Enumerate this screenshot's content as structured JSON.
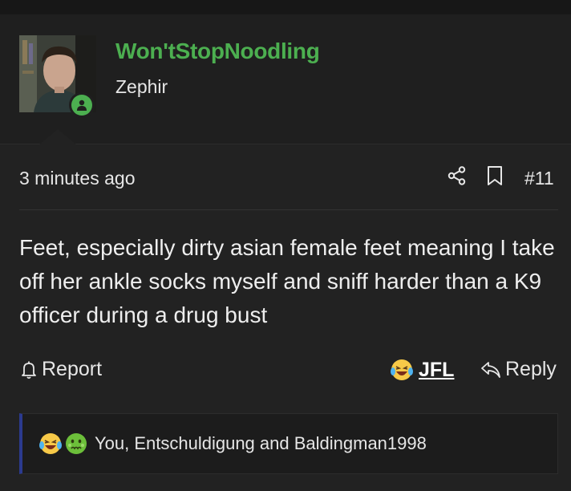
{
  "user": {
    "name": "Won'tStopNoodling",
    "title": "Zephir",
    "status": "online"
  },
  "post": {
    "timestamp": "3 minutes ago",
    "number": "#11",
    "body": "Feet, especially dirty asian female feet meaning I take off her ankle socks myself and sniff harder than a K9 officer during a drug bust"
  },
  "actions": {
    "report_label": "Report",
    "react_label": "JFL",
    "reply_label": "Reply"
  },
  "reactions": {
    "names": "You, Entschuldigung and Baldingman1998",
    "emojis": [
      "crying-laughing-emoji",
      "nauseated-emoji"
    ]
  },
  "colors": {
    "accent": "#4caf50",
    "reaction_border": "#2b3a8f",
    "background": "#222222"
  }
}
